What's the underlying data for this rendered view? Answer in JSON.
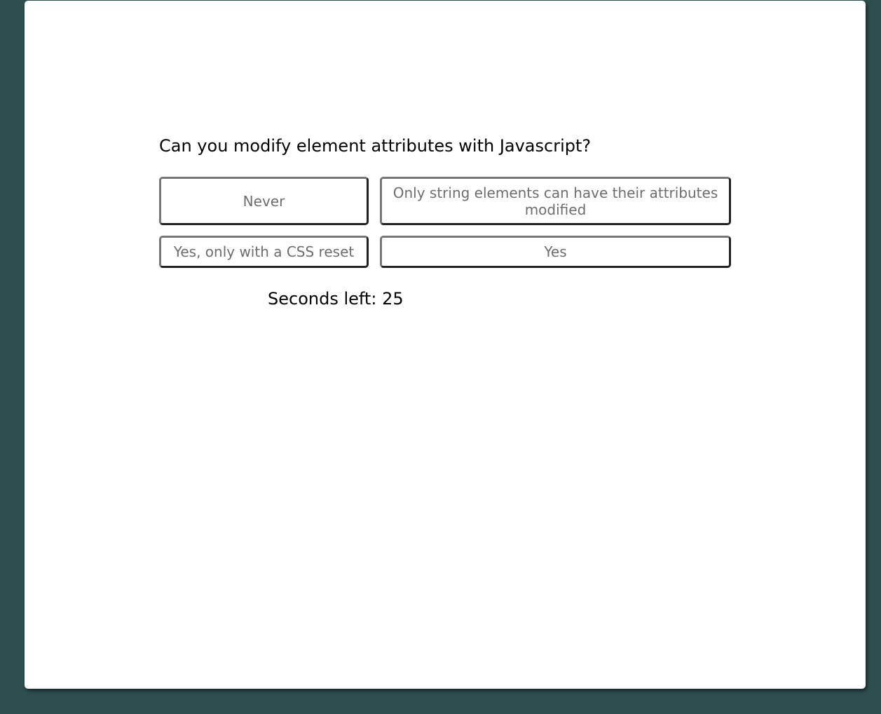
{
  "quiz": {
    "question": "Can you modify element attributes with Javascript?",
    "answers": [
      "Never",
      "Only string elements can have their attributes modified",
      "Yes, only with a CSS reset",
      "Yes"
    ],
    "timer_label": "Seconds left:",
    "seconds_left": "25"
  },
  "colors": {
    "page_background": "#2f4f4f",
    "card_background": "#ffffff",
    "answer_text": "#6d6d6d"
  }
}
